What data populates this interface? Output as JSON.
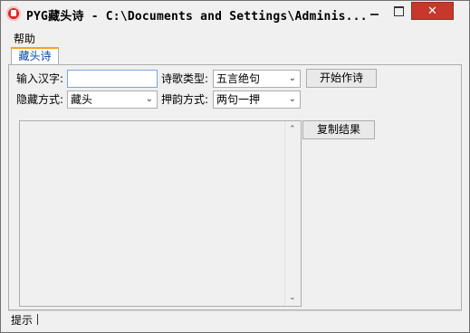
{
  "window": {
    "title": "PYG藏头诗 - C:\\Documents and Settings\\Adminis...",
    "close_glyph": "✕"
  },
  "menu": {
    "help": "帮助"
  },
  "tabs": [
    {
      "label": "藏头诗"
    }
  ],
  "form": {
    "input_label": "输入汉字:",
    "input_value": "",
    "poem_type_label": "诗歌类型:",
    "poem_type_value": "五言绝句",
    "start_button": "开始作诗",
    "hide_mode_label": "隐藏方式:",
    "hide_mode_value": "藏头",
    "rhyme_mode_label": "押韵方式:",
    "rhyme_mode_value": "两句一押",
    "copy_button": "复制结果"
  },
  "result": {
    "text": ""
  },
  "status": {
    "text": "提示"
  }
}
